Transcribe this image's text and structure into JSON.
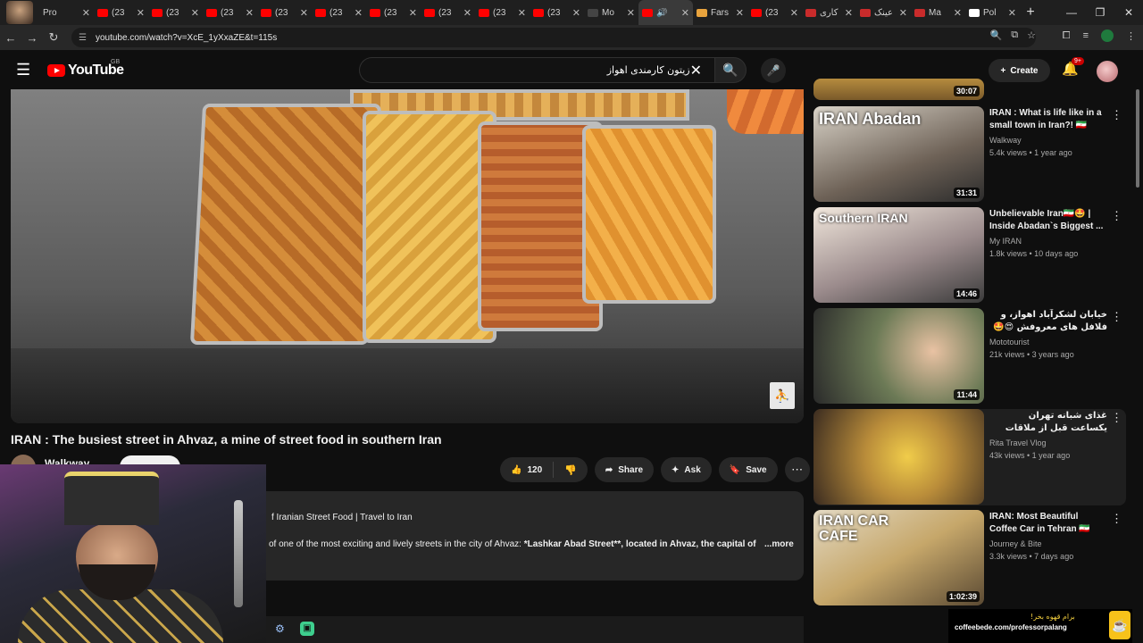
{
  "browser": {
    "tabs": [
      {
        "title": "Pro",
        "favicon": "profile-avatar-icon"
      },
      {
        "title": "(23",
        "favicon": "youtube-icon"
      },
      {
        "title": "(23",
        "favicon": "youtube-icon"
      },
      {
        "title": "(23",
        "favicon": "youtube-icon"
      },
      {
        "title": "(23",
        "favicon": "youtube-icon"
      },
      {
        "title": "(23",
        "favicon": "youtube-icon"
      },
      {
        "title": "(23",
        "favicon": "youtube-icon"
      },
      {
        "title": "(23",
        "favicon": "youtube-icon"
      },
      {
        "title": "(23",
        "favicon": "youtube-icon"
      },
      {
        "title": "(23",
        "favicon": "youtube-icon"
      },
      {
        "title": "Mo",
        "favicon": "dark-icon"
      },
      {
        "title": "",
        "favicon": "youtube-icon",
        "active": true,
        "audio": "speaker-icon"
      },
      {
        "title": "Fars",
        "favicon": "orange-icon"
      },
      {
        "title": "(23",
        "favicon": "youtube-icon"
      },
      {
        "title": "کاری",
        "favicon": "red-icon"
      },
      {
        "title": "عینک",
        "favicon": "red-icon"
      },
      {
        "title": "Ma",
        "favicon": "gmail-icon"
      },
      {
        "title": "Pol",
        "favicon": "wikipedia-icon"
      }
    ],
    "url": "youtube.com/watch?v=XcE_1yXxaZE&t=115s"
  },
  "header": {
    "logo_text": "YouTube",
    "country_code": "GB",
    "search_value": "زیتون کارمندی اهواز",
    "create_label": "Create",
    "notifications_badge": "9+"
  },
  "video": {
    "title": "IRAN : The busiest street in Ahvaz, a mine of street food in southern Iran",
    "channel": "Walkway",
    "likes": "120",
    "share_label": "Share",
    "ask_label": "Ask",
    "save_label": "Save",
    "desc_line1": "f Iranian Street Food | Travel to Iran",
    "desc_line2_plain": "of one of the most exciting and lively streets in the city of Ahvaz: ",
    "desc_line2_bold": "*Lashkar Abad Street**, located in Ahvaz, the capital of",
    "more_label": "...more"
  },
  "related": [
    {
      "duration": "30:07",
      "title": "",
      "channel": "",
      "meta": ""
    },
    {
      "title": "IRAN : What is life like in a small town in Iran?! 🇮🇷 Wha...",
      "channel": "Walkway",
      "meta": "5.4k views • 1 year ago",
      "duration": "31:31",
      "overlay": "IRAN Abadan"
    },
    {
      "title": "Unbelievable Iran🇮🇷🤩 | Inside Abadan`s Biggest ...",
      "channel": "My IRAN",
      "meta": "1.8k views • 10 days ago",
      "duration": "14:46",
      "overlay": "Southern IRAN"
    },
    {
      "title": "خیابان لشکرآباد اهواز، و فلافل های معروفش 😍🤩",
      "channel": "Mototourist",
      "meta": "21k views • 3 years ago",
      "duration": "11:44",
      "overlay": ""
    },
    {
      "title": "غذای شبانه تهران یکساعت قبل از ملاقات اخیر | تست بهترین غذاهای شب",
      "channel": "Rita Travel Vlog",
      "meta": "43k views • 1 year ago",
      "duration": "",
      "overlay": ""
    },
    {
      "title": "IRAN: Most Beautiful Coffee Car in Tehran 🇮🇷 Hidden ...",
      "channel": "Journey & Bite",
      "meta": "3.3k views • 7 days ago",
      "duration": "1:02:39",
      "overlay": "IRAN CAR CAFE"
    }
  ],
  "coffee_banner": {
    "title": "برام قهوه بخر!",
    "url": "coffeebede.com/professorpalang"
  }
}
